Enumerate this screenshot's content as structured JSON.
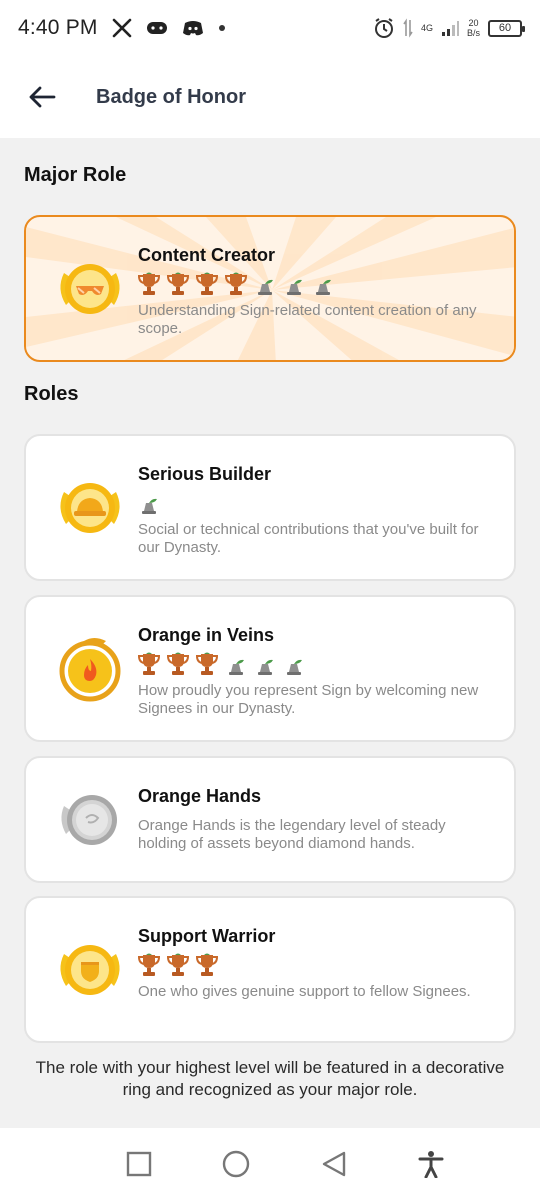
{
  "status_bar": {
    "time": "4:40 PM",
    "network_type": "4G",
    "speed_value": "20",
    "speed_unit": "B/s",
    "battery": "60"
  },
  "header": {
    "title": "Badge of Honor"
  },
  "major_section": {
    "title": "Major Role",
    "card": {
      "name": "Content Creator",
      "description": "Understanding Sign-related content creation of any scope.",
      "earned": 4,
      "total": 7,
      "badge_icon": "sunglasses-badge-icon"
    }
  },
  "roles_section": {
    "title": "Roles",
    "items": [
      {
        "name": "Serious Builder",
        "description": "Social or technical contributions that you've built for our Dynasty.",
        "earned": 0,
        "total": 1,
        "badge_icon": "hard-hat-badge-icon"
      },
      {
        "name": "Orange in Veins",
        "description": "How proudly you represent Sign by welcoming new Signees in our Dynasty.",
        "earned": 3,
        "total": 6,
        "badge_icon": "dragon-flame-badge-icon"
      },
      {
        "name": "Orange Hands",
        "description": "Orange Hands is the legendary level of steady holding of assets beyond diamond hands.",
        "earned": 0,
        "total": 0,
        "badge_icon": "silver-coin-badge-icon"
      },
      {
        "name": "Support Warrior",
        "description": "One who gives genuine support to fellow Signees.",
        "earned": 3,
        "total": 3,
        "badge_icon": "shield-badge-icon"
      }
    ]
  },
  "footer_note": "The role with your highest level will be featured in a decorative ring and recognized as your major role.",
  "colors": {
    "accent": "#ea8a1e",
    "badge_gold": "#f6c21a",
    "trophy_bronze": "#c9692a",
    "locked_grey": "#8f8f8f"
  }
}
